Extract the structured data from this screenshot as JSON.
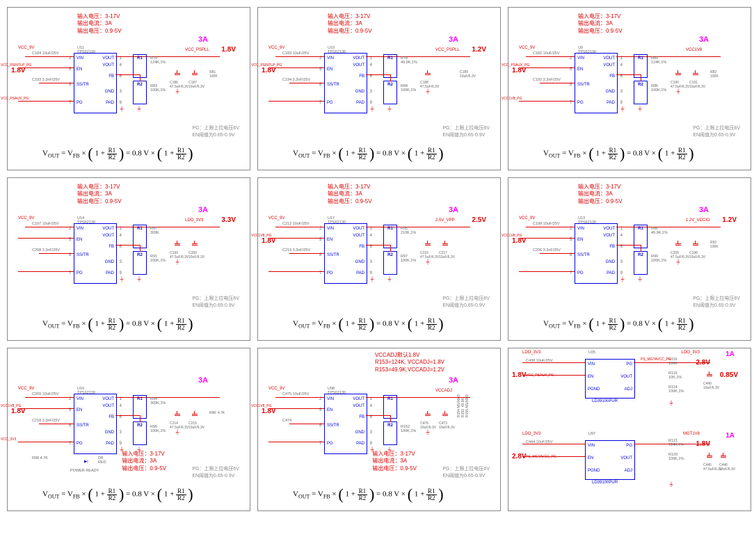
{
  "common": {
    "spec1": "输入电压：3-17V",
    "spec2": "输出电流：3A",
    "spec3": "输出电压：0.9-5V",
    "curr": "3A",
    "pg1": "PG：上限上拉电压6V",
    "pg2": "EN阈值为0.65-0.9V",
    "formula_vout": "V",
    "formula_out": "OUT",
    "formula_eq": " = V",
    "formula_fb": "FB",
    "formula_x": " × ",
    "formula_08": " = 0.8 V × ",
    "r1": "R1",
    "r2": "R2",
    "one": "1 + ",
    "chip_part": "TPS62130",
    "pins": {
      "vin": "VIN",
      "vout": "VOUT",
      "en": "EN",
      "fb": "FB",
      "sstr": "SS/TR",
      "gnd": "GND",
      "pg": "PG",
      "pad": "PAD",
      "adj": "ADJ",
      "pgnd": "PGND"
    }
  },
  "cells": [
    {
      "id": "c1",
      "vout": "1.8V",
      "vleft": "1.8V",
      "vin": "VCC_9V",
      "u": "U11",
      "out_net": "VCC_PSPLL",
      "en_net": "VCC_PSINTLP_PG",
      "pg_net": "VCC_PSAUX_PG",
      "c_in": "C184  10uF/25V",
      "c_ss": "C193  3.3nF/25V",
      "r1v": "R79\n124K,1%",
      "r2v": "R83\n100K,1%",
      "cout": "C186\n47.5uF/6.3V",
      "cout2": "C187\n10uF/6.3V",
      "rpg": "R81\n100K"
    },
    {
      "id": "c2",
      "vout": "1.2V",
      "vleft": "1.8V",
      "vin": "VCC_9V",
      "u": "U10",
      "out_net": "VCC_PSPLL",
      "en_net": "VCC_PSINTLP_PG",
      "pg_net": "",
      "c_in": "C183  10uF/25V",
      "c_ss": "C194  3.3nF/25V",
      "r1v": "R78\n49.9K,1%",
      "r2v": "R84\n100K,1%",
      "cout": "C188\n47.5uF/6.3V",
      "cout2": "",
      "rpg": "C189\n10uF/6.3V"
    },
    {
      "id": "c3",
      "vout": "",
      "vleft": "1.8V",
      "vin": "VCC_9V",
      "u": "U9",
      "out_net": "VCC1V8",
      "en_net": "VCC_PSAUX_PG",
      "pg_net": "VCC1V8_PG",
      "c_in": "C182  10uF/25V",
      "c_ss": "C192  3.3nF/25V",
      "r1v": "R80\n124K,1%",
      "r2v": "R85\n100K,1%",
      "cout": "C190\n47.5uF/6.3V",
      "cout2": "C191\n10uF/6.3V",
      "rpg": "R82\n100K"
    },
    {
      "id": "c4",
      "vout": "3.3V",
      "vleft": "",
      "vin": "VCC_9V",
      "u": "U14",
      "out_net": "LDO_3V3",
      "en_net": "",
      "pg_net": "",
      "c_in": "C197  10uF/25V",
      "c_ss": "C208  3.3nF/25V",
      "r1v": "R87\n309K",
      "r2v": "R91\n100K,1%",
      "cout": "C199\n47.5uF/6.3V",
      "cout2": "C200\n10uF/6.3V",
      "rpg": ""
    },
    {
      "id": "c5",
      "vout": "2.5V",
      "vleft": "1.8V",
      "vin": "VCC_9V",
      "u": "U17",
      "out_net": "2.5V_VPP",
      "en_net": "VCC1V8_PG",
      "pg_net": "",
      "c_in": "C212  10uF/25V",
      "c_ss": "C219  3.3nF/25V",
      "r1v": "R95\n210K,1%",
      "r2v": "R97\n100K,1%",
      "cout": "C216\n47.5uF/6.3V",
      "cout2": "C217\n10uF/6.3V",
      "rpg": ""
    },
    {
      "id": "c6",
      "vout": "1.2V",
      "vleft": "1.8V",
      "vin": "VCC_9V",
      "u": "U13",
      "out_net": "1.2V_VCCIO",
      "en_net": "VCC1V8_PG",
      "pg_net": "",
      "c_in": "C198  10uF/25V",
      "c_ss": "C206  3.3nF/25V",
      "r1v": "R86\n49.9K,1%",
      "r2v": "R90\n100K,1%",
      "cout": "C205\n47.5uF/6.3V",
      "cout2": "C198\n10uF/6.3V",
      "rpg": "R92\n100K"
    },
    {
      "id": "c7",
      "vout": "",
      "vleft": "1.8V",
      "vin": "VCC_9V",
      "u": "U16",
      "out_net": "",
      "en_net": "VCC1V8_PG",
      "pg_net": "VCC_3V3",
      "c_in": "C209  10uF/25V",
      "c_ss": "C218  3.3nF/25V",
      "r1v": "R94\n309K,1%",
      "r2v": "R96\n100K,1%",
      "cout": "C214\n47.5uF/6.3V",
      "cout2": "C215\n10uF/6.3V",
      "rpg": "R98  4.7K",
      "led": "D8\nRED",
      "ledlbl": "POWER READY",
      "specs_bottom": true
    },
    {
      "id": "c8",
      "vout": "",
      "vleft": "1.8V",
      "vin": "VCC_9V",
      "u": "U98",
      "out_net": "VCCADJ",
      "en_net": "VCC1V8_PG",
      "pg_net": "",
      "c_in": "C475  10uF/25V",
      "c_ss": "C474",
      "r1v": "",
      "r2v": "R152\n100K,1%",
      "cout": "C476\n10uF/6.3V",
      "cout2": "C473\n10uF/6.3V",
      "rpg": "",
      "extra1": "VCCADJ默认1.8V",
      "extra2": "R153=124K, VCCADJ=1.8V",
      "extra3": "R153=49.9K,VCCADJ=1.2V",
      "sw": "R154 NS/0603\nR153  49.9K\nR155 NS/0603",
      "specs_bottom": true
    }
  ],
  "ldos": {
    "u25": {
      "u": "U25",
      "part": "LD39100PUR",
      "vin": "LDO_3V3",
      "out": "LDO_3V3",
      "vout": "2.8V",
      "curr": "1A",
      "en": "VCC_PSAUX_PG",
      "vleft": "1.8V",
      "pg": "PS_MGTAVCC_PG",
      "vright": "0.85V",
      "cin": "C438  10uF/25V",
      "r1": "R116\n100K",
      "r2": "R115\n10K,1%",
      "r3": "R114\n100K,1%",
      "cout": "C440\n10uF/6.3V"
    },
    "u97": {
      "u": "U97",
      "part": "LD39100PUR",
      "vin": "LDO_3V3",
      "out": "MGT1V8",
      "vout": "1.8V",
      "curr": "1A",
      "en": "PS_MGTAVCC_PG",
      "vleft": "2.8V",
      "cin": "C444  10uF/25V",
      "r1": "R121\n124K,1%",
      "r2": "R120\n100K,1%",
      "cout": "C445\n47.5uF/6.3V",
      "cout2": "C446\n10uF/6.3V"
    }
  }
}
